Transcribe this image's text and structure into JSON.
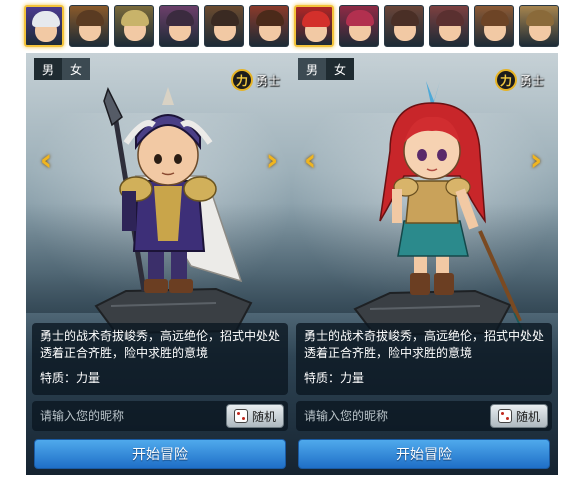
{
  "portraits": [
    {
      "hair": "#e6e9ee",
      "accent": "#4b3a8f",
      "selected": true
    },
    {
      "hair": "#5a3b22",
      "accent": "#8a5a2a",
      "selected": false
    },
    {
      "hair": "#c8b36a",
      "accent": "#7a6a3a",
      "selected": false
    },
    {
      "hair": "#3b2b3f",
      "accent": "#6c3f6a",
      "selected": false
    },
    {
      "hair": "#3a2a22",
      "accent": "#6b4b2f",
      "selected": false
    },
    {
      "hair": "#4b2a1a",
      "accent": "#8a3a2a",
      "selected": false
    },
    {
      "hair": "#d3302b",
      "accent": "#b02525",
      "selected": true
    },
    {
      "hair": "#b2304f",
      "accent": "#8f2a45",
      "selected": false
    },
    {
      "hair": "#4a2f26",
      "accent": "#6a4538",
      "selected": false
    },
    {
      "hair": "#5a3030",
      "accent": "#7d4040",
      "selected": false
    },
    {
      "hair": "#6d4426",
      "accent": "#8c5a35",
      "selected": false
    },
    {
      "hair": "#8a6a3a",
      "accent": "#a6844e",
      "selected": false
    }
  ],
  "panels": [
    {
      "gender": {
        "male": "男",
        "female": "女",
        "active": "male"
      },
      "class_icon": "力",
      "class_label": "勇士",
      "arrow_left": "‹",
      "arrow_right": "›",
      "character": "male-warrior",
      "description": "勇士的战术奇拔峻秀，高远绝伦，招式中处处透着正合齐胜，险中求胜的意境",
      "trait": "特质：力量",
      "name_placeholder": "请输入您的昵称",
      "random_label": "随机",
      "start_label": "开始冒险"
    },
    {
      "gender": {
        "male": "男",
        "female": "女",
        "active": "female"
      },
      "class_icon": "力",
      "class_label": "勇士",
      "arrow_left": "‹",
      "arrow_right": "›",
      "character": "female-warrior",
      "description": "勇士的战术奇拔峻秀，高远绝伦，招式中处处透着正合齐胜，险中求胜的意境",
      "trait": "特质：力量",
      "name_placeholder": "请输入您的昵称",
      "random_label": "随机",
      "start_label": "开始冒险"
    }
  ],
  "colors": {
    "gold": "#f0b51f",
    "button_blue": "#2f86d9",
    "panel_dark": "#152330"
  }
}
